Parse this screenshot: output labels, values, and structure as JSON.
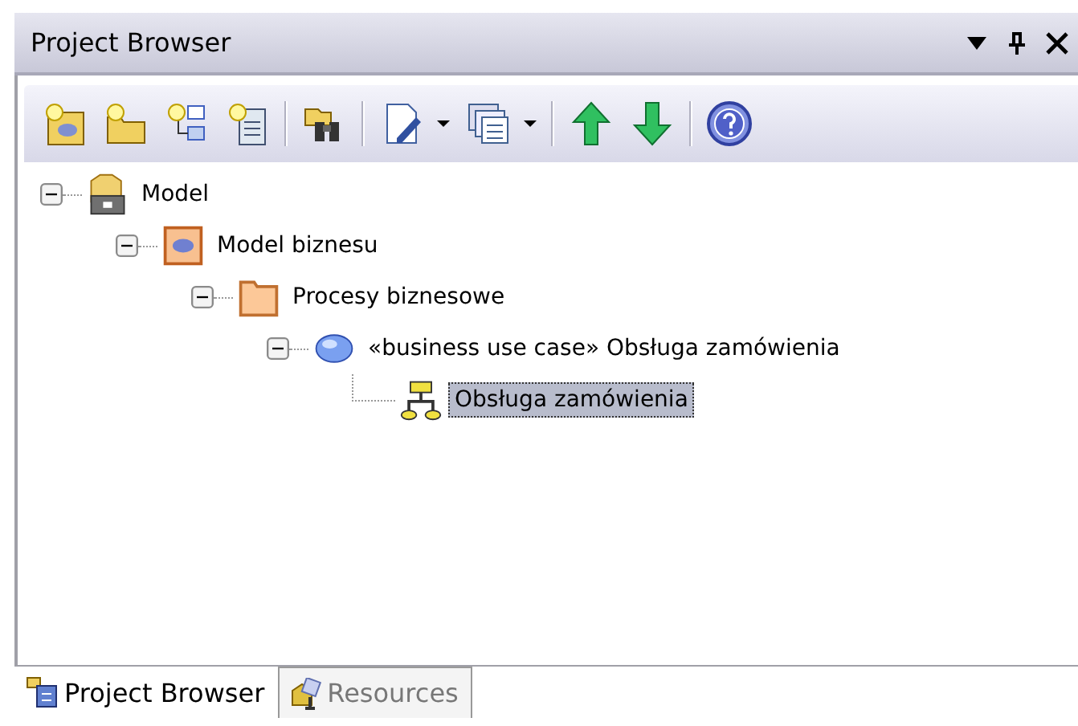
{
  "window": {
    "title": "Project Browser"
  },
  "tree": [
    {
      "label": "Model",
      "kind": "model",
      "expanded": true,
      "selected": false,
      "children": [
        {
          "label": "Model biznesu",
          "kind": "view",
          "expanded": true,
          "selected": false,
          "children": [
            {
              "label": "Procesy biznesowe",
              "kind": "folder",
              "expanded": true,
              "selected": false,
              "children": [
                {
                  "label": "«business use case» Obsługa zamówienia",
                  "kind": "usecase",
                  "expanded": true,
                  "selected": false,
                  "children": [
                    {
                      "label": "Obsługa zamówienia",
                      "kind": "activity",
                      "selected": true
                    }
                  ]
                }
              ]
            }
          ]
        }
      ]
    }
  ],
  "tabs": [
    {
      "label": "Project Browser",
      "selected": true
    },
    {
      "label": "Resources",
      "selected": false
    }
  ]
}
